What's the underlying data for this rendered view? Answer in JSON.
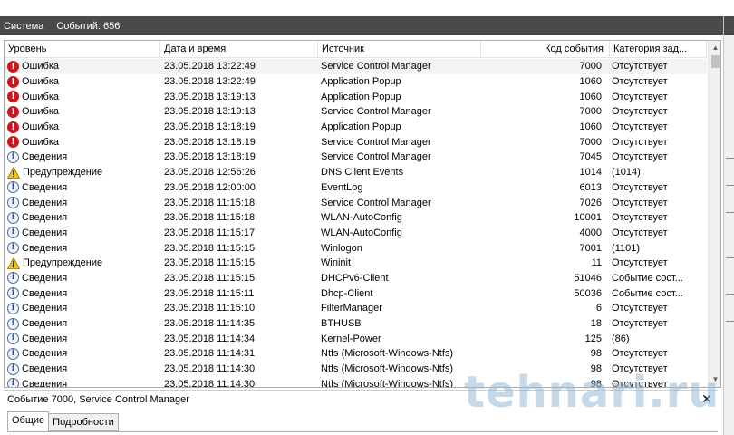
{
  "header": {
    "title": "Система",
    "count": "Событий: 656"
  },
  "columns": {
    "level": "Уровень",
    "date": "Дата и время",
    "source": "Источник",
    "code": "Код события",
    "category": "Категория зад..."
  },
  "rows": [
    {
      "type": "error",
      "level": "Ошибка",
      "date": "23.05.2018 13:22:49",
      "source": "Service Control Manager",
      "code": "7000",
      "category": "Отсутствует"
    },
    {
      "type": "error",
      "level": "Ошибка",
      "date": "23.05.2018 13:22:49",
      "source": "Application Popup",
      "code": "1060",
      "category": "Отсутствует"
    },
    {
      "type": "error",
      "level": "Ошибка",
      "date": "23.05.2018 13:19:13",
      "source": "Application Popup",
      "code": "1060",
      "category": "Отсутствует"
    },
    {
      "type": "error",
      "level": "Ошибка",
      "date": "23.05.2018 13:19:13",
      "source": "Service Control Manager",
      "code": "7000",
      "category": "Отсутствует"
    },
    {
      "type": "error",
      "level": "Ошибка",
      "date": "23.05.2018 13:18:19",
      "source": "Application Popup",
      "code": "1060",
      "category": "Отсутствует"
    },
    {
      "type": "error",
      "level": "Ошибка",
      "date": "23.05.2018 13:18:19",
      "source": "Service Control Manager",
      "code": "7000",
      "category": "Отсутствует"
    },
    {
      "type": "info",
      "level": "Сведения",
      "date": "23.05.2018 13:18:19",
      "source": "Service Control Manager",
      "code": "7045",
      "category": "Отсутствует"
    },
    {
      "type": "warning",
      "level": "Предупреждение",
      "date": "23.05.2018 12:56:26",
      "source": "DNS Client Events",
      "code": "1014",
      "category": "(1014)"
    },
    {
      "type": "info",
      "level": "Сведения",
      "date": "23.05.2018 12:00:00",
      "source": "EventLog",
      "code": "6013",
      "category": "Отсутствует"
    },
    {
      "type": "info",
      "level": "Сведения",
      "date": "23.05.2018 11:15:18",
      "source": "Service Control Manager",
      "code": "7026",
      "category": "Отсутствует"
    },
    {
      "type": "info",
      "level": "Сведения",
      "date": "23.05.2018 11:15:18",
      "source": "WLAN-AutoConfig",
      "code": "10001",
      "category": "Отсутствует"
    },
    {
      "type": "info",
      "level": "Сведения",
      "date": "23.05.2018 11:15:17",
      "source": "WLAN-AutoConfig",
      "code": "4000",
      "category": "Отсутствует"
    },
    {
      "type": "info",
      "level": "Сведения",
      "date": "23.05.2018 11:15:15",
      "source": "Winlogon",
      "code": "7001",
      "category": "(1101)"
    },
    {
      "type": "warning",
      "level": "Предупреждение",
      "date": "23.05.2018 11:15:15",
      "source": "Wininit",
      "code": "11",
      "category": "Отсутствует"
    },
    {
      "type": "info",
      "level": "Сведения",
      "date": "23.05.2018 11:15:15",
      "source": "DHCPv6-Client",
      "code": "51046",
      "category": "Событие сост..."
    },
    {
      "type": "info",
      "level": "Сведения",
      "date": "23.05.2018 11:15:11",
      "source": "Dhcp-Client",
      "code": "50036",
      "category": "Событие сост..."
    },
    {
      "type": "info",
      "level": "Сведения",
      "date": "23.05.2018 11:15:10",
      "source": "FilterManager",
      "code": "6",
      "category": "Отсутствует"
    },
    {
      "type": "info",
      "level": "Сведения",
      "date": "23.05.2018 11:14:35",
      "source": "BTHUSB",
      "code": "18",
      "category": "Отсутствует"
    },
    {
      "type": "info",
      "level": "Сведения",
      "date": "23.05.2018 11:14:34",
      "source": "Kernel-Power",
      "code": "125",
      "category": "(86)"
    },
    {
      "type": "info",
      "level": "Сведения",
      "date": "23.05.2018 11:14:31",
      "source": "Ntfs (Microsoft-Windows-Ntfs)",
      "code": "98",
      "category": "Отсутствует"
    },
    {
      "type": "info",
      "level": "Сведения",
      "date": "23.05.2018 11:14:30",
      "source": "Ntfs (Microsoft-Windows-Ntfs)",
      "code": "98",
      "category": "Отсутствует"
    },
    {
      "type": "info",
      "level": "Сведения",
      "date": "23.05.2018 11:14:30",
      "source": "Ntfs (Microsoft-Windows-Ntfs)",
      "code": "98",
      "category": "Отсутствует"
    }
  ],
  "detail": {
    "title": "Событие 7000, Service Control Manager",
    "close": "✕",
    "tabs": [
      "Общие",
      "Подробности"
    ]
  },
  "scroll": {
    "up": "▲",
    "down": "▼"
  },
  "watermark": "tehnari.ru",
  "colors": {
    "header_bg": "#4a4a4a",
    "error_red": "#c8171d",
    "warning_yellow": "#f5c518",
    "info_blue": "#4d6a96"
  }
}
